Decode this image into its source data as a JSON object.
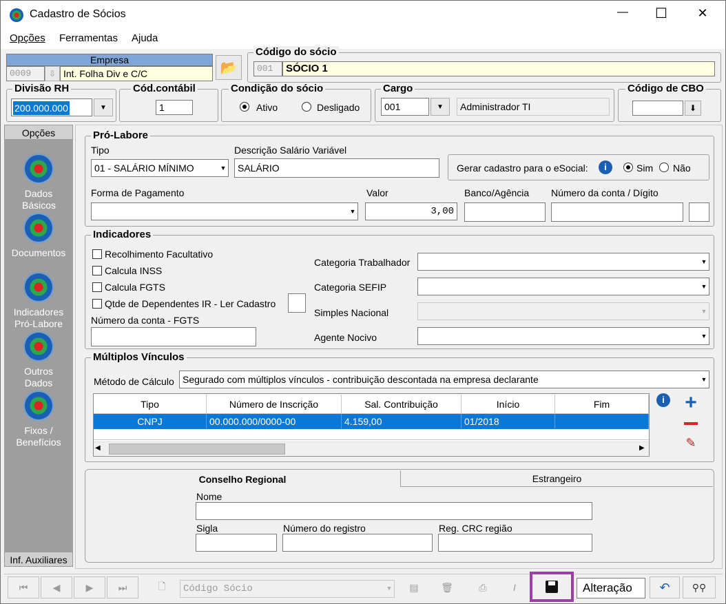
{
  "window": {
    "title": "Cadastro de Sócios",
    "minimize": "—",
    "maximize": "☐",
    "close": "✕"
  },
  "menu": [
    "Opções",
    "Ferramentas",
    "Ajuda"
  ],
  "empresa": {
    "header": "Empresa",
    "code": "0009",
    "name": "Int. Folha Div e C/C"
  },
  "codigo_socio": {
    "title": "Código do sócio",
    "code": "001",
    "name": "SÓCIO 1"
  },
  "divisao_rh": {
    "title": "Divisão RH",
    "value": "200.000.000"
  },
  "cod_contabil": {
    "title": "Cód.contábil",
    "value": "1"
  },
  "condicao": {
    "title": "Condição do sócio",
    "ativo": "Ativo",
    "desligado": "Desligado",
    "selected": "Ativo"
  },
  "cargo": {
    "title": "Cargo",
    "code": "001",
    "description": "Administrador TI"
  },
  "cbo": {
    "title": "Código de CBO",
    "value": ""
  },
  "sidebar": {
    "header": "Opções",
    "items": [
      "Dados Básicos",
      "Documentos",
      "Indicadores Pró-Labore",
      "Outros Dados",
      "Fixos / Benefícios"
    ],
    "footer": "Inf. Auxiliares"
  },
  "pro_labore": {
    "title": "Pró-Labore",
    "tipo_label": "Tipo",
    "tipo_value": "01 - SALÁRIO MÍNIMO",
    "desc_label": "Descrição Salário Variável",
    "desc_value": "SALÁRIO",
    "esocial_label": "Gerar cadastro para o eSocial:",
    "esocial_sim": "Sim",
    "esocial_nao": "Não",
    "forma_label": "Forma de Pagamento",
    "forma_value": "",
    "valor_label": "Valor",
    "valor_value": "3,00",
    "banco_label": "Banco/Agência",
    "conta_label": "Número da conta / Dígito"
  },
  "indicadores": {
    "title": "Indicadores",
    "checks": [
      "Recolhimento Facultativo",
      "Calcula INSS",
      "Calcula FGTS",
      "Qtde de Dependentes IR - Ler Cadastro"
    ],
    "fgts_label": "Número da conta - FGTS",
    "categoria_trab": "Categoria Trabalhador",
    "categoria_sefip": "Categoria SEFIP",
    "simples": "Simples Nacional",
    "agente": "Agente Nocivo"
  },
  "multiplos": {
    "title": "Múltiplos Vínculos",
    "metodo_label": "Método de Cálculo",
    "metodo_value": "Segurado com múltiplos vínculos - contribuição descontada na empresa declarante",
    "columns": [
      "Tipo",
      "Número de Inscrição",
      "Sal. Contribuição",
      "Início",
      "Fim"
    ],
    "row": [
      "CNPJ",
      "00.000.000/0000-00",
      "4.159,00",
      "01/2018",
      ""
    ]
  },
  "tabs": {
    "active": "Conselho Regional",
    "other": "Estrangeiro",
    "nome": "Nome",
    "sigla": "Sigla",
    "numero_registro": "Número do registro",
    "reg_crc": "Reg. CRC região"
  },
  "toolbar": {
    "search_placeholder": "Código Sócio",
    "status": "Alteração"
  },
  "colors": {
    "accent_select": "#0a78d7",
    "yellow_field": "#ffffe1",
    "save_highlight": "#9b3fa6",
    "sidebar": "#9e9e9e"
  }
}
